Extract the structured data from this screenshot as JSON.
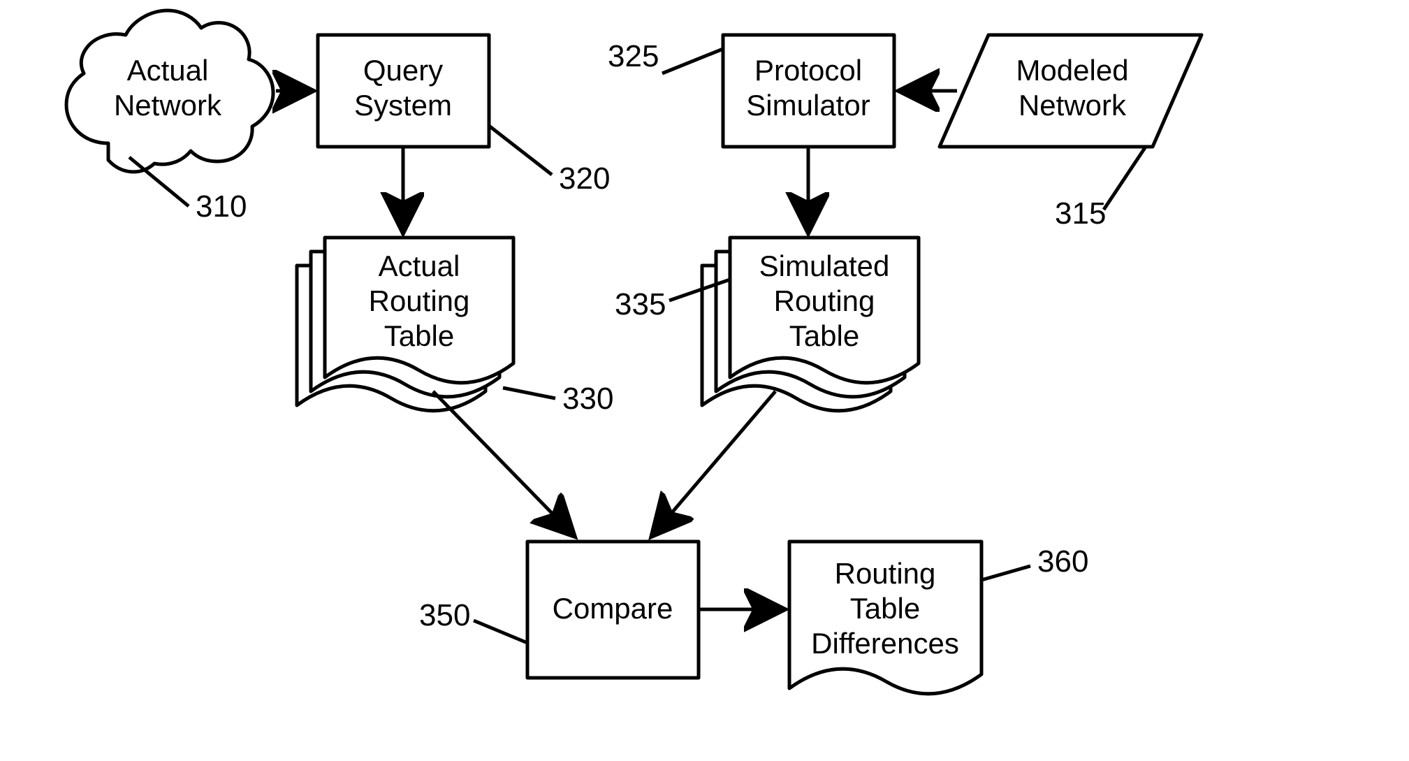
{
  "nodes": {
    "actual_network": {
      "line1": "Actual",
      "line2": "Network",
      "ref": "310"
    },
    "query_system": {
      "line1": "Query",
      "line2": "System",
      "ref": "320"
    },
    "protocol_sim": {
      "line1": "Protocol",
      "line2": "Simulator",
      "ref": "325"
    },
    "modeled_network": {
      "line1": "Modeled",
      "line2": "Network",
      "ref": "315"
    },
    "actual_rt": {
      "line1": "Actual",
      "line2": "Routing",
      "line3": "Table",
      "ref": "330"
    },
    "sim_rt": {
      "line1": "Simulated",
      "line2": "Routing",
      "line3": "Table",
      "ref": "335"
    },
    "compare": {
      "line1": "Compare",
      "ref": "350"
    },
    "differences": {
      "line1": "Routing",
      "line2": "Table",
      "line3": "Differences",
      "ref": "360"
    }
  }
}
